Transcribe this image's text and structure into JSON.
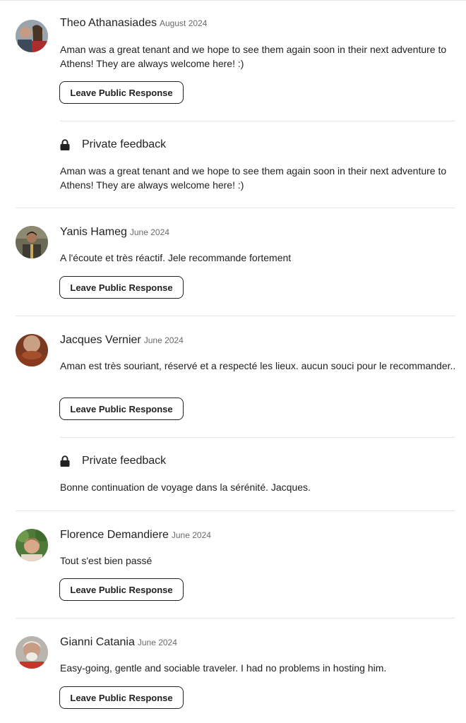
{
  "button_label": "Leave Public Response",
  "private_feedback_label": "Private feedback",
  "reviews": [
    {
      "name": "Theo Athanasiades",
      "date": "August 2024",
      "text": "Aman was a great tenant and we hope to see them again soon in their next adventure to Athens! They are always welcome here! :)",
      "private_feedback": "Aman was a great tenant and we hope to see them again soon in their next adventure to Athens! They are always welcome here! :)"
    },
    {
      "name": "Yanis Hameg",
      "date": "June 2024",
      "text": "A l'écoute et très réactif. Jele recommande fortement"
    },
    {
      "name": "Jacques Vernier",
      "date": "June 2024",
      "text": "Aman est très souriant, réservé et a respecté les lieux. aucun souci pour le recommander..",
      "private_feedback": "Bonne continuation de voyage dans la sérénité. Jacques."
    },
    {
      "name": "Florence Demandiere",
      "date": "June 2024",
      "text": "Tout s'est bien passé"
    },
    {
      "name": "Gianni Catania",
      "date": "June 2024",
      "text": "Easy-going, gentle and sociable traveler. I had no problems in hosting him."
    }
  ]
}
